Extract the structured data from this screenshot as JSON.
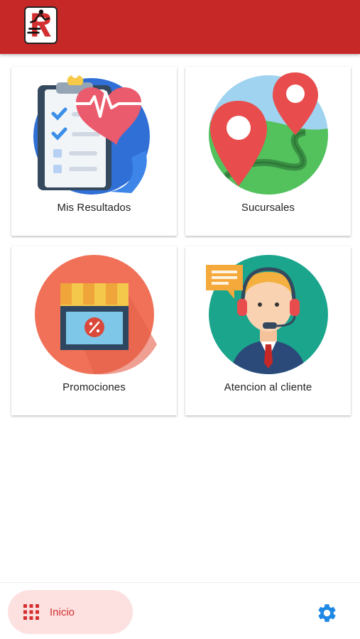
{
  "header": {
    "logo": {
      "name": "app-logo",
      "color": "#c62828"
    }
  },
  "menu": {
    "items": [
      {
        "label": "Mis Resultados",
        "icon": "medical-results-icon"
      },
      {
        "label": "Sucursales",
        "icon": "map-location-icon"
      },
      {
        "label": "Promociones",
        "icon": "store-discount-icon"
      },
      {
        "label": "Atencion al cliente",
        "icon": "customer-support-icon"
      }
    ]
  },
  "bottom_nav": {
    "home": {
      "label": "Inicio",
      "icon": "grid-icon",
      "active": true
    },
    "settings": {
      "icon": "gear-icon"
    }
  },
  "colors": {
    "primary": "#c62828",
    "accent": "#d32f2f",
    "nav_active_bg": "#fde0e0",
    "settings_icon": "#1e88e5"
  }
}
